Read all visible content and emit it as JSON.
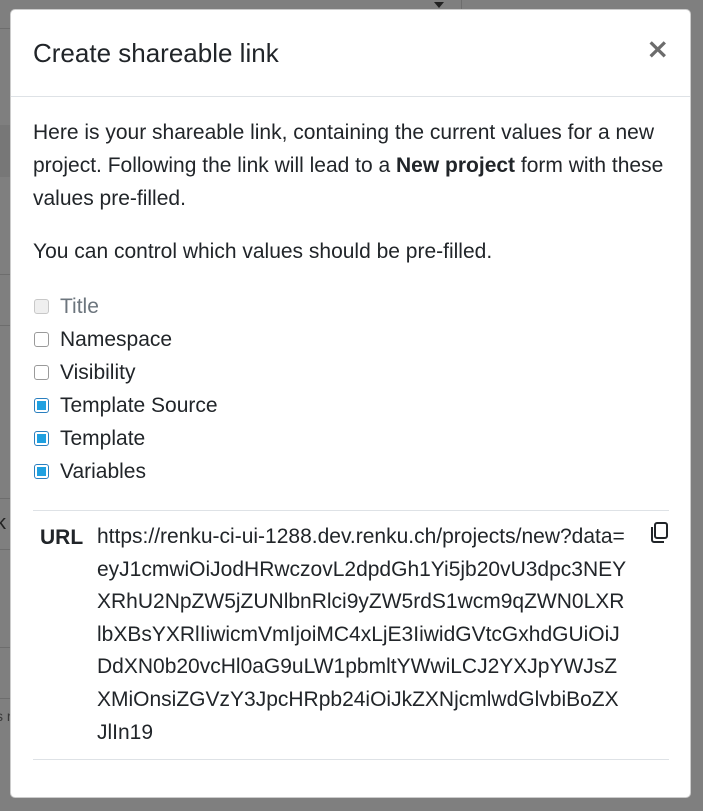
{
  "background": {
    "partial_text_1": "k",
    "partial_text_2": "s r"
  },
  "modal": {
    "title": "Create shareable link",
    "close_glyph": "×",
    "intro_part1": "Here is your shareable link, containing the current values for a new project. Following the link will lead to a ",
    "intro_bold": "New project",
    "intro_part2": " form with these values pre-filled.",
    "control_text": "You can control which values should be pre-filled.",
    "options": [
      {
        "label": "Title",
        "checked": false,
        "disabled": true
      },
      {
        "label": "Namespace",
        "checked": false,
        "disabled": false
      },
      {
        "label": "Visibility",
        "checked": false,
        "disabled": false
      },
      {
        "label": "Template Source",
        "checked": true,
        "disabled": false
      },
      {
        "label": "Template",
        "checked": true,
        "disabled": false
      },
      {
        "label": "Variables",
        "checked": true,
        "disabled": false
      }
    ],
    "url_label": "URL",
    "url_value": "https://renku-ci-ui-1288.dev.renku.ch/projects/new?data=eyJ1cmwiOiJodHRwczovL2dpdGh1Yi5jb20vU3dpc3NEYXRhU2NpZW5jZUNlbnRlci9yZW5rdS1wcm9qZWN0LXRlbXBsYXRlIiwicmVmIjoiMC4xLjE3IiwidGVtcGxhdGUiOiJDdXN0b20vcHl0aG9uLW1pbmltYWwiLCJ2YXJpYWJsZXMiOnsiZGVzY3JpcHRpb24iOiJkZXNjcmlwdGlvbiBoZXJlIn19",
    "copy_icon": "copy-icon",
    "colors": {
      "checkbox_accent": "#1fa0e0",
      "overlay": "#7f7f7f"
    }
  }
}
